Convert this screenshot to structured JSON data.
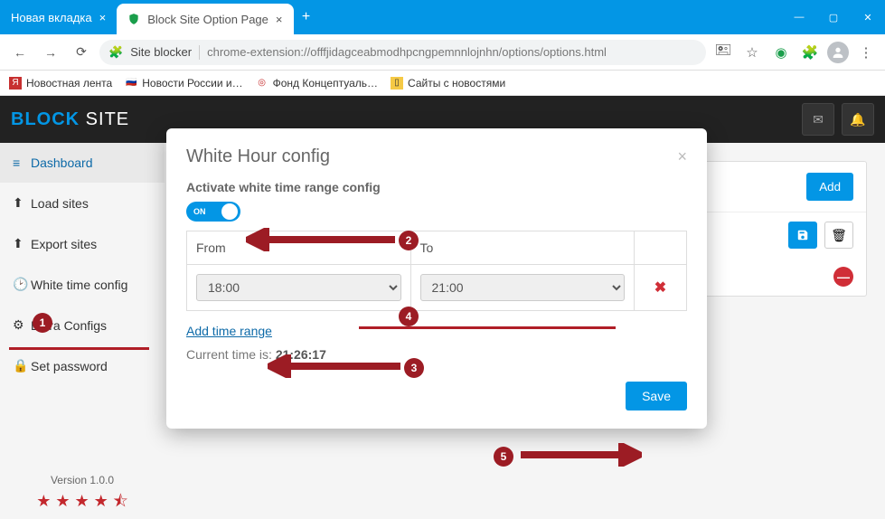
{
  "tabs": {
    "new_tab": "Новая вкладка",
    "active_tab": "Block Site Option Page"
  },
  "omnibox": {
    "pagename": "Site blocker",
    "url": "chrome-extension://offfjidagceabmodhpcngpemnnlojnhn/options/options.html"
  },
  "bookmarks": {
    "b1": "Новостная лента",
    "b2": "Новости России и…",
    "b3": "Фонд Концептуаль…",
    "b4": "Сайты с новостями"
  },
  "logo": {
    "b": "BLOCK",
    "s": " SITE"
  },
  "sidebar": {
    "dashboard": "Dashboard",
    "load": "Load sites",
    "export": "Export sites",
    "white": "White time config",
    "extra": "Extra Configs",
    "password": "Set password",
    "version": "Version 1.0.0"
  },
  "main": {
    "add_label": "Add"
  },
  "modal": {
    "title": "White Hour config",
    "activate_label": "Activate white time range config",
    "toggle_on": "ON",
    "from_label": "From",
    "to_label": "To",
    "from_value": "18:00",
    "to_value": "21:00",
    "add_range": "Add time range",
    "current_time_prefix": "Current time is: ",
    "current_time": "21:26:17",
    "save_label": "Save"
  },
  "annot": {
    "n1": "1",
    "n2": "2",
    "n3": "3",
    "n4": "4",
    "n5": "5"
  }
}
